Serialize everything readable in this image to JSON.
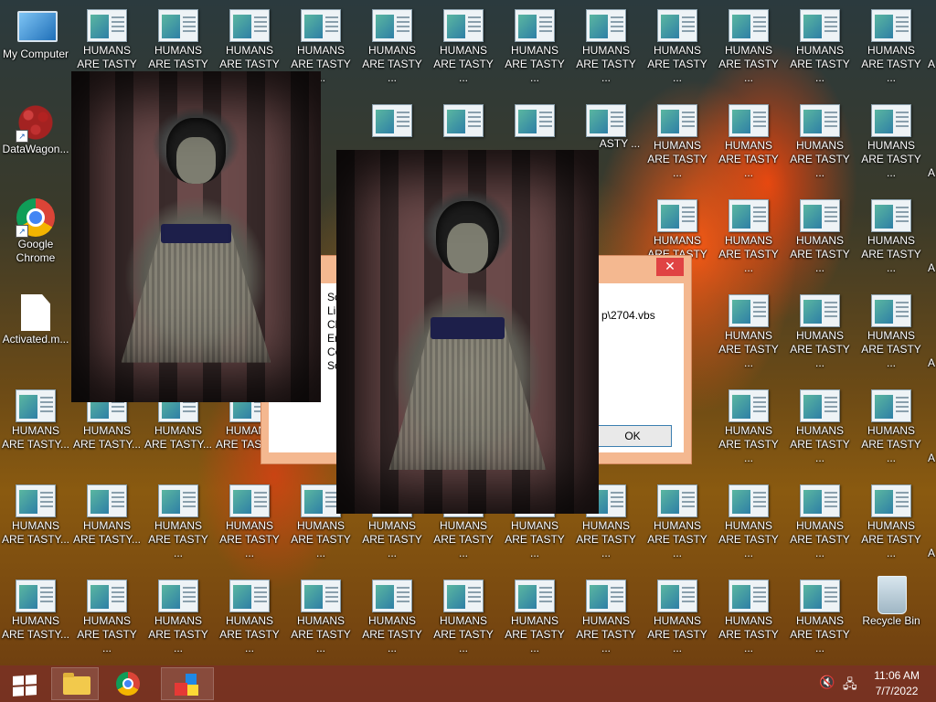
{
  "desktop": {
    "system_icons": [
      {
        "label": "My Computer",
        "icon": "my-computer-icon"
      },
      {
        "label": "DataWagon...",
        "icon": "molecule-icon"
      },
      {
        "label": "Google Chrome",
        "icon": "chrome-icon"
      },
      {
        "label": "Activated.m...",
        "icon": "document-icon"
      },
      {
        "label": "Recycle Bin",
        "icon": "recycle-bin-icon"
      }
    ],
    "spam_labels": {
      "full": "HUMANS ARE TASTY ...",
      "short": "HUMANS ARE TASTY...",
      "clipped": "HUMANS ARE TASTY"
    },
    "visible_fragments": {
      "clipped_a": "A",
      "partial_tasty": "ASTY ...",
      "partial_humans": "HUMA",
      "partial_s": "S",
      "partial_y": "Y ..."
    }
  },
  "dialog": {
    "path_text": "p\\2704.vbs",
    "body_letters": [
      "Sc",
      "Lin",
      "Ch",
      "Er",
      "Co",
      "So"
    ],
    "ok_label": "OK",
    "close_glyph": "✕"
  },
  "taskbar": {
    "time": "11:06 AM",
    "date": "7/7/2022",
    "start_icon": "windows-logo-icon",
    "apps": [
      "file-explorer-icon",
      "chrome-icon",
      "blocks-app-icon"
    ],
    "tray_volume_glyph": "🔇",
    "tray_network_glyph": "🖧"
  },
  "colors": {
    "taskbar": "#78322380",
    "dialog_border": "#f4b890",
    "close_button": "#e04343"
  }
}
